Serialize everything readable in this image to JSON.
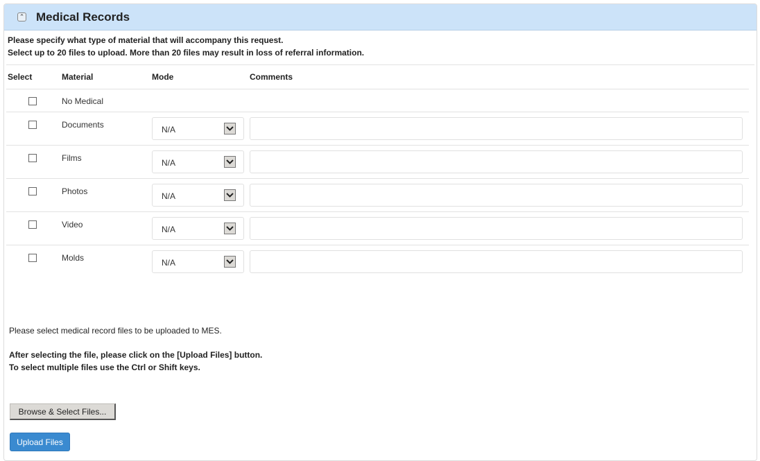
{
  "panel": {
    "title": "Medical Records",
    "collapse_icon": "double-chevron-up-icon"
  },
  "intro": {
    "line1": "Please specify what type of material that will accompany this request.",
    "line2": "Select up to 20 files to upload. More than 20 files may result in loss of referral information."
  },
  "table": {
    "headers": {
      "select": "Select",
      "material": "Material",
      "mode": "Mode",
      "comments": "Comments"
    },
    "no_medical": {
      "label": "No Medical",
      "checked": false
    },
    "rows": [
      {
        "material": "Documents",
        "checked": false,
        "mode": "N/A",
        "comment": ""
      },
      {
        "material": "Films",
        "checked": false,
        "mode": "N/A",
        "comment": ""
      },
      {
        "material": "Photos",
        "checked": false,
        "mode": "N/A",
        "comment": ""
      },
      {
        "material": "Video",
        "checked": false,
        "mode": "N/A",
        "comment": ""
      },
      {
        "material": "Molds",
        "checked": false,
        "mode": "N/A",
        "comment": ""
      }
    ]
  },
  "instructions": {
    "select_files": "Please select medical record files to be uploaded to MES.",
    "after_selecting": "After selecting the file, please click on the [Upload Files] button.",
    "multiple_files": "To select multiple files use the Ctrl or Shift keys."
  },
  "buttons": {
    "browse": "Browse & Select Files...",
    "upload": "Upload Files"
  },
  "colors": {
    "header_bg": "#cce3f9",
    "upload_button": "#3a8ad0",
    "browse_button": "#dcdad6"
  }
}
